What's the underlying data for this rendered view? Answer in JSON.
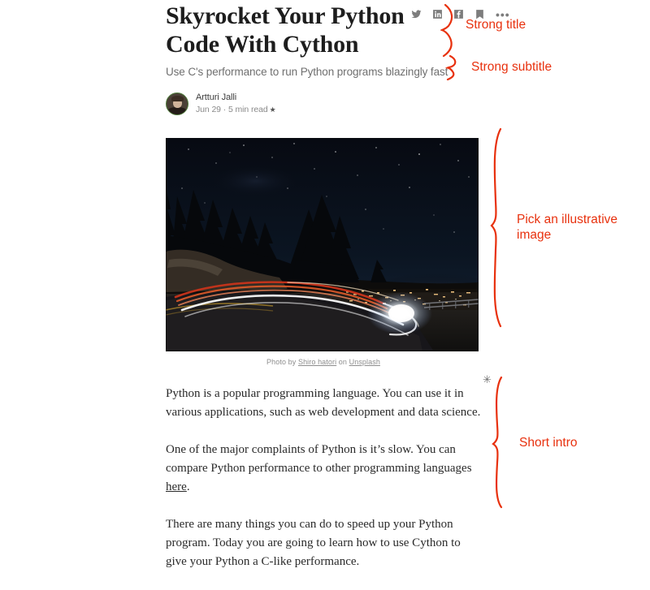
{
  "article": {
    "title": "Skyrocket Your Python Code With Cython",
    "subtitle": "Use C's performance to run Python programs blazingly fast",
    "byline": {
      "author": "Artturi Jalli",
      "meta": "Jun 29 · 5 min read",
      "star_glyph": "★",
      "avatar_name": "author-avatar"
    },
    "social": {
      "twitter": "twitter-icon",
      "linkedin": "linkedin-icon",
      "facebook": "facebook-icon",
      "bookmark": "bookmark-icon",
      "more": "•••"
    },
    "hero": {
      "alt": "Night mountain road with long-exposure car light trails above a city",
      "caption_prefix": "Photo by ",
      "caption_author": "Shiro hatori",
      "caption_mid": " on ",
      "caption_source": "Unsplash"
    },
    "paragraphs": [
      {
        "before": "Python is a popular programming language. You can use it in various applications, such as web development and data science.",
        "link": "",
        "after": ""
      },
      {
        "before": "One of the major complaints of Python is it’s slow. You can compare Python performance to other programming languages ",
        "link": "here",
        "after": "."
      },
      {
        "before": "There are many things you can do to speed up your Python program. Today you are going to learn how to use Cython to give your Python a C-like performance.",
        "link": "",
        "after": ""
      }
    ]
  },
  "annotations": {
    "color": "#e8310e",
    "title_label": "Strong title",
    "subtitle_label": "Strong subtitle",
    "image_label": "Pick an illustrative\nimage",
    "intro_label": "Short intro",
    "asterisk": "✳"
  }
}
